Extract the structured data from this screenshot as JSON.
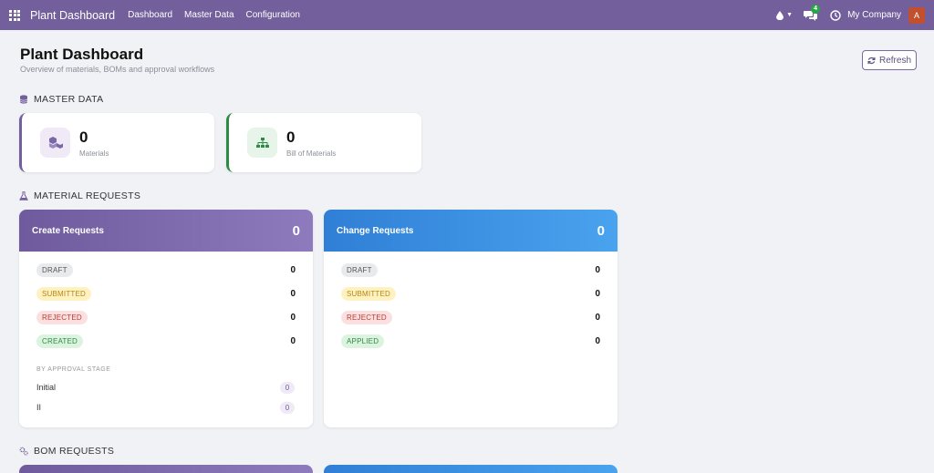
{
  "navbar": {
    "brand": "Plant Dashboard",
    "menu": [
      "Dashboard",
      "Master Data",
      "Configuration"
    ],
    "chat_badge": "4",
    "company": "My Company",
    "avatar_letter": "A"
  },
  "header": {
    "title": "Plant Dashboard",
    "subtitle": "Overview of materials, BOMs and approval workflows",
    "refresh_label": "Refresh"
  },
  "master_data": {
    "section_title": "MASTER DATA",
    "materials": {
      "value": "0",
      "label": "Materials"
    },
    "boms": {
      "value": "0",
      "label": "Bill of Materials"
    }
  },
  "material_requests": {
    "section_title": "MATERIAL REQUESTS",
    "create": {
      "title": "Create Requests",
      "count": "0",
      "states": [
        {
          "label": "DRAFT",
          "count": "0"
        },
        {
          "label": "SUBMITTED",
          "count": "0"
        },
        {
          "label": "REJECTED",
          "count": "0"
        },
        {
          "label": "CREATED",
          "count": "0"
        }
      ],
      "stage_heading": "BY APPROVAL STAGE",
      "stages": [
        {
          "label": "Initial",
          "count": "0"
        },
        {
          "label": "II",
          "count": "0"
        }
      ]
    },
    "change": {
      "title": "Change Requests",
      "count": "0",
      "states": [
        {
          "label": "DRAFT",
          "count": "0"
        },
        {
          "label": "SUBMITTED",
          "count": "0"
        },
        {
          "label": "REJECTED",
          "count": "0"
        },
        {
          "label": "APPLIED",
          "count": "0"
        }
      ]
    }
  },
  "bom_requests": {
    "section_title": "BOM REQUESTS"
  },
  "colors": {
    "navbar": "#725f9c",
    "create_header": "#6e5a9c",
    "change_header": "#2f7fd6",
    "bom_accent": "#2e8b45"
  }
}
